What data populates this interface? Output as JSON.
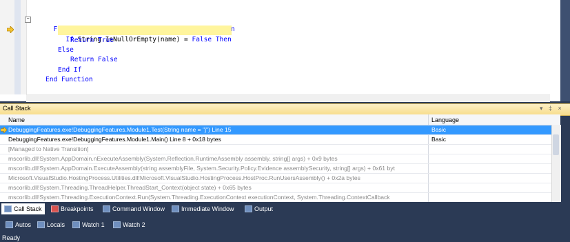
{
  "editor": {
    "lines": [
      {
        "pre": "Function Test(ByVal name As String) As Boolean",
        "kind": "decl"
      },
      {
        "pre": "If String.IsNullOrEmpty(name) = False Then",
        "kind": "current"
      },
      {
        "pre": "Return True",
        "kind": "normal"
      },
      {
        "pre": "Else",
        "kind": "normal"
      },
      {
        "pre": "Return False",
        "kind": "normal"
      },
      {
        "pre": "End If",
        "kind": "normal"
      },
      {
        "pre": "End Function",
        "kind": "normal"
      }
    ]
  },
  "call_stack": {
    "title": "Call Stack",
    "controls": "▾ ‡ ×",
    "columns": {
      "name": "Name",
      "language": "Language"
    },
    "rows": [
      {
        "name": "DebuggingFeatures.exe!DebuggingFeatures.Module1.Test(String name = \"j\") Line 15",
        "language": "Basic"
      },
      {
        "name": "DebuggingFeatures.exe!DebuggingFeatures.Module1.Main() Line 8 + 0x18 bytes",
        "language": "Basic"
      },
      {
        "name": "[Managed to Native Transition]",
        "language": ""
      },
      {
        "name": "mscorlib.dll!System.AppDomain.nExecuteAssembly(System.Reflection.RuntimeAssembly assembly, string[] args) + 0x9 bytes",
        "language": ""
      },
      {
        "name": "mscorlib.dll!System.AppDomain.ExecuteAssembly(string assemblyFile, System.Security.Policy.Evidence assemblySecurity, string[] args) + 0x61 byt",
        "language": ""
      },
      {
        "name": "Microsoft.VisualStudio.HostingProcess.Utilities.dll!Microsoft.VisualStudio.HostingProcess.HostProc.RunUsersAssembly() + 0x2a bytes",
        "language": ""
      },
      {
        "name": "mscorlib.dll!System.Threading.ThreadHelper.ThreadStart_Context(object state) + 0x65 bytes",
        "language": ""
      },
      {
        "name": "mscorlib.dll!System.Threading.ExecutionContext.Run(System.Threading.ExecutionContext executionContext, System.Threading.ContextCallback",
        "language": ""
      }
    ]
  },
  "tabs_row1": [
    "Call Stack",
    "Breakpoints",
    "Command Window",
    "Immediate Window",
    "Output"
  ],
  "tabs_row2": [
    "Autos",
    "Locals",
    "Watch 1",
    "Watch 2"
  ],
  "status": "Ready",
  "colors": {
    "accent": "#3399ff",
    "highlight": "#fff59d",
    "chrome": "#2b3a55"
  }
}
